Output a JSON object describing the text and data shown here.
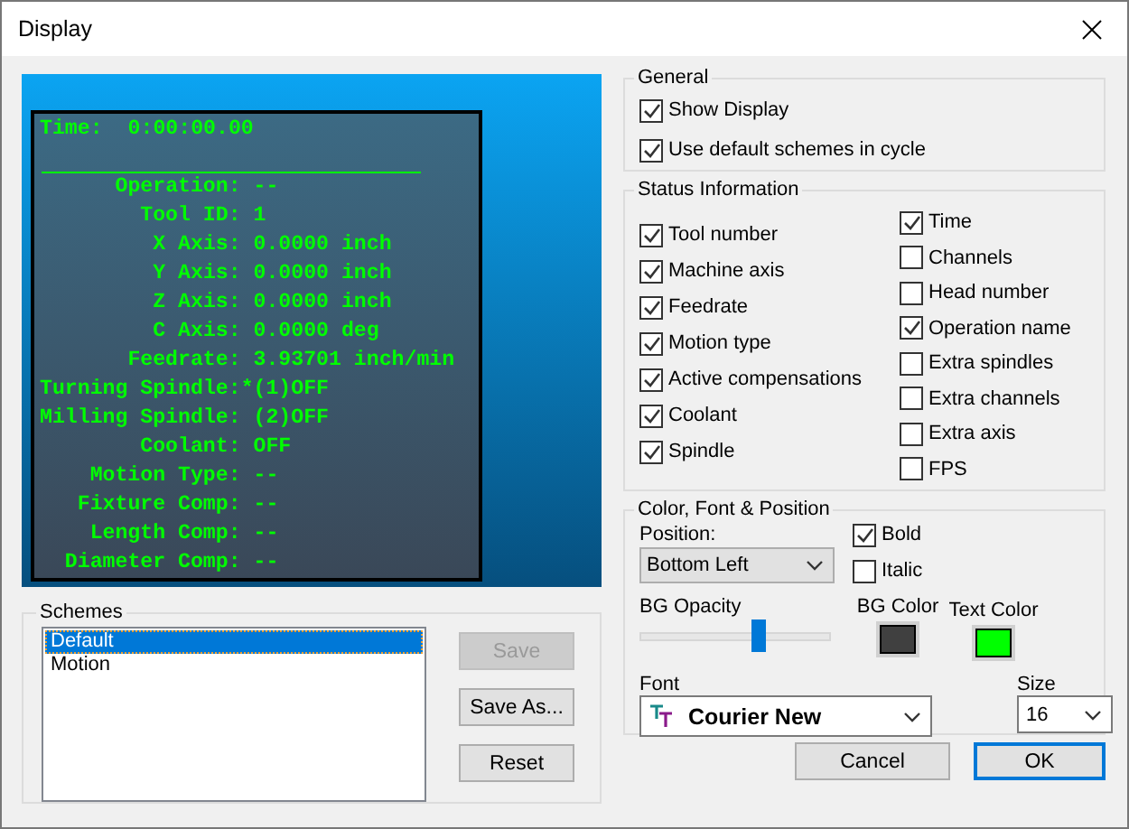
{
  "window": {
    "title": "Display"
  },
  "preview": {
    "time_label": "Time:",
    "time": "0:00:00.00",
    "lines": [
      "Operation: --",
      "Tool ID: 1",
      "X Axis: 0.0000 inch",
      "Y Axis: 0.0000 inch",
      "Z Axis: 0.0000 inch",
      "C Axis: 0.0000 deg",
      "Feedrate: 3.93701 inch/min",
      "Turning Spindle:*(1)OFF",
      "Milling Spindle: (2)OFF",
      "Coolant: OFF",
      "Motion Type: --",
      "Fixture Comp: --",
      "Length Comp: --",
      "Diameter Comp: --"
    ]
  },
  "schemes": {
    "title": "Schemes",
    "items": [
      {
        "label": "Default",
        "selected": true
      },
      {
        "label": "Motion",
        "selected": false
      }
    ],
    "buttons": [
      {
        "label": "Save",
        "disabled": true
      },
      {
        "label": "Save As...",
        "disabled": false
      },
      {
        "label": "Reset",
        "disabled": false
      }
    ]
  },
  "general": {
    "title": "General",
    "options": [
      {
        "label": "Show Display",
        "checked": true
      },
      {
        "label": "Use default schemes in cycle",
        "checked": true
      }
    ]
  },
  "status_information": {
    "title": "Status Information",
    "columns": [
      [
        {
          "label": "Tool number",
          "checked": true
        },
        {
          "label": "Machine axis",
          "checked": true
        },
        {
          "label": "Feedrate",
          "checked": true
        },
        {
          "label": "Motion type",
          "checked": true
        },
        {
          "label": "Active compensations",
          "checked": true
        },
        {
          "label": "Coolant",
          "checked": true
        },
        {
          "label": "Spindle",
          "checked": true
        }
      ],
      [
        {
          "label": "Time",
          "checked": true
        },
        {
          "label": "Channels",
          "checked": false
        },
        {
          "label": "Head number",
          "checked": false
        },
        {
          "label": "Operation name",
          "checked": true
        },
        {
          "label": "Extra spindles",
          "checked": false
        },
        {
          "label": "Extra channels",
          "checked": false
        },
        {
          "label": "Extra axis",
          "checked": false
        },
        {
          "label": "FPS",
          "checked": false
        }
      ]
    ]
  },
  "color_font_position": {
    "title": "Color, Font & Position",
    "position": {
      "label": "Position:",
      "value": "Bottom Left"
    },
    "bold": {
      "label": "Bold",
      "checked": true
    },
    "italic": {
      "label": "Italic",
      "checked": false
    },
    "bg_opacity": {
      "label": "BG Opacity",
      "level": 0.62
    },
    "bg_color": {
      "label": "BG Color",
      "color": "#404040"
    },
    "text_color": {
      "label": "Text Color",
      "color": "#00ff00"
    },
    "font": {
      "label": "Font",
      "value": "Courier New"
    },
    "size": {
      "label": "Size",
      "value": "16"
    }
  },
  "buttons": [
    {
      "label": "Cancel",
      "default": false
    },
    {
      "label": "OK",
      "default": true
    }
  ]
}
